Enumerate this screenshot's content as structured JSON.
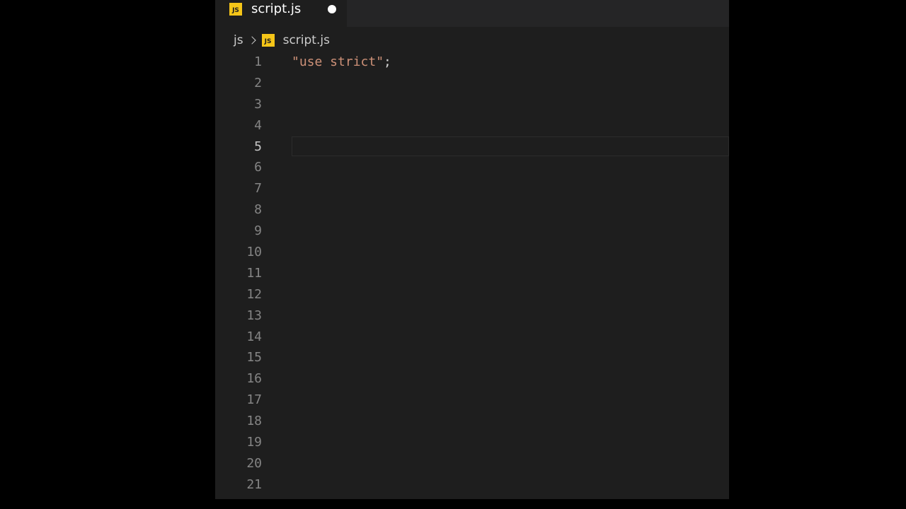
{
  "tab": {
    "icon_text": "JS",
    "label": "script.js"
  },
  "breadcrumb": {
    "folder": "js",
    "icon_text": "JS",
    "file": "script.js"
  },
  "editor": {
    "line_numbers": [
      "1",
      "2",
      "3",
      "4",
      "5",
      "6",
      "7",
      "8",
      "9",
      "10",
      "11",
      "12",
      "13",
      "14",
      "15",
      "16",
      "17",
      "18",
      "19",
      "20",
      "21"
    ],
    "active_line": "5",
    "lines": [
      {
        "string": "\"use strict\"",
        "punct": ";"
      }
    ]
  },
  "colors": {
    "background": "#000000",
    "editor_bg": "#1e1e1e",
    "string": "#ce9178",
    "js_icon": "#f5c518"
  }
}
